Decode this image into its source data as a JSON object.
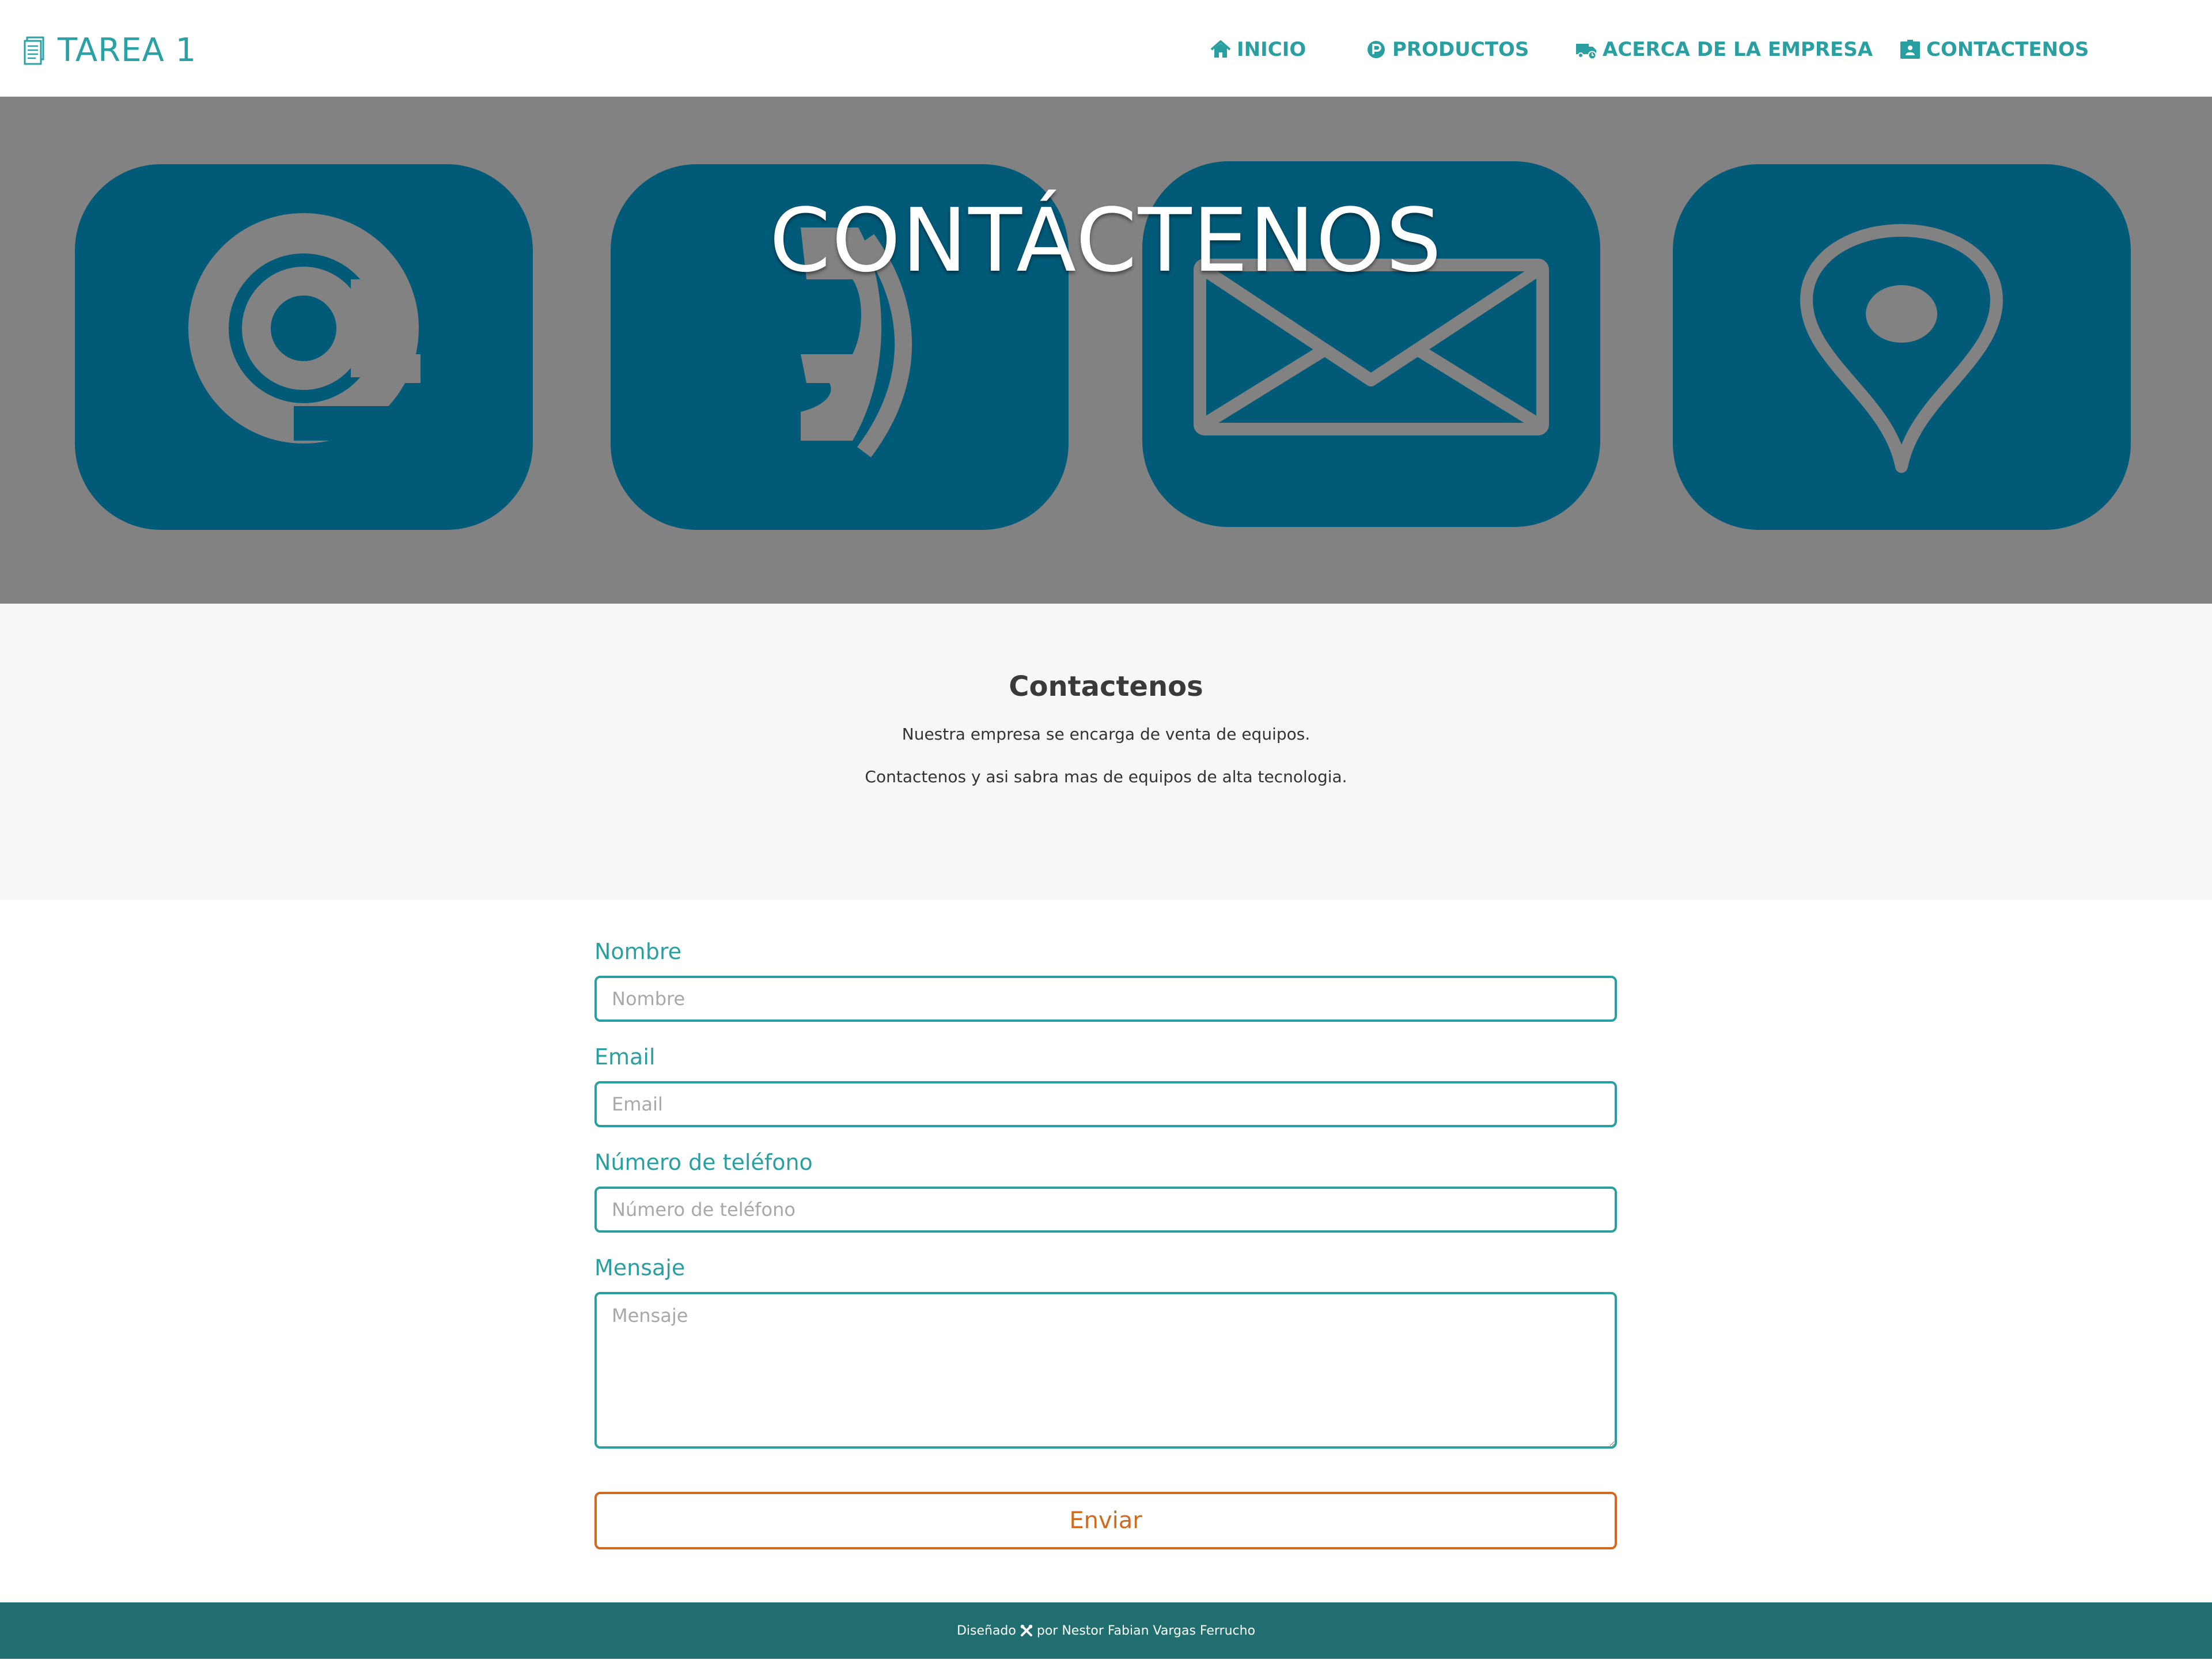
{
  "brand": {
    "icon": "document-icon",
    "title": "TAREA 1"
  },
  "nav": {
    "items": [
      {
        "label": "INICIO",
        "icon": "home-icon"
      },
      {
        "label": "PRODUCTOS",
        "icon": "parking-circle-icon"
      },
      {
        "label": "ACERCA DE LA EMPRESA",
        "icon": "shipping-truck-icon"
      },
      {
        "label": "CONTACTENOS",
        "icon": "id-badge-icon"
      }
    ]
  },
  "hero": {
    "title": "CONTÁCTENOS",
    "tiles": [
      "at-sign-icon",
      "phone-handset-icon",
      "envelope-icon",
      "location-pin-icon"
    ]
  },
  "info": {
    "title": "Contactenos",
    "paragraph1": "Nuestra empresa se encarga de venta de equipos.",
    "paragraph2": "Contactenos y asi sabra mas de equipos de alta tecnologia."
  },
  "form": {
    "name_label": "Nombre",
    "name_placeholder": "Nombre",
    "email_label": "Email",
    "email_placeholder": "Email",
    "phone_label": "Número de teléfono",
    "phone_placeholder": "Número de teléfono",
    "message_label": "Mensaje",
    "message_placeholder": "Mensaje",
    "submit_label": "Enviar"
  },
  "footer": {
    "prefix": "Diseñado",
    "icon": "tools-icon",
    "suffix": "por Nestor Fabian Vargas Ferrucho"
  },
  "colors": {
    "accent": "#2a9fa1",
    "hero_bg": "#828282",
    "tile": "#025a79",
    "submit": "#d4681c",
    "footer_bg": "#206e70"
  }
}
